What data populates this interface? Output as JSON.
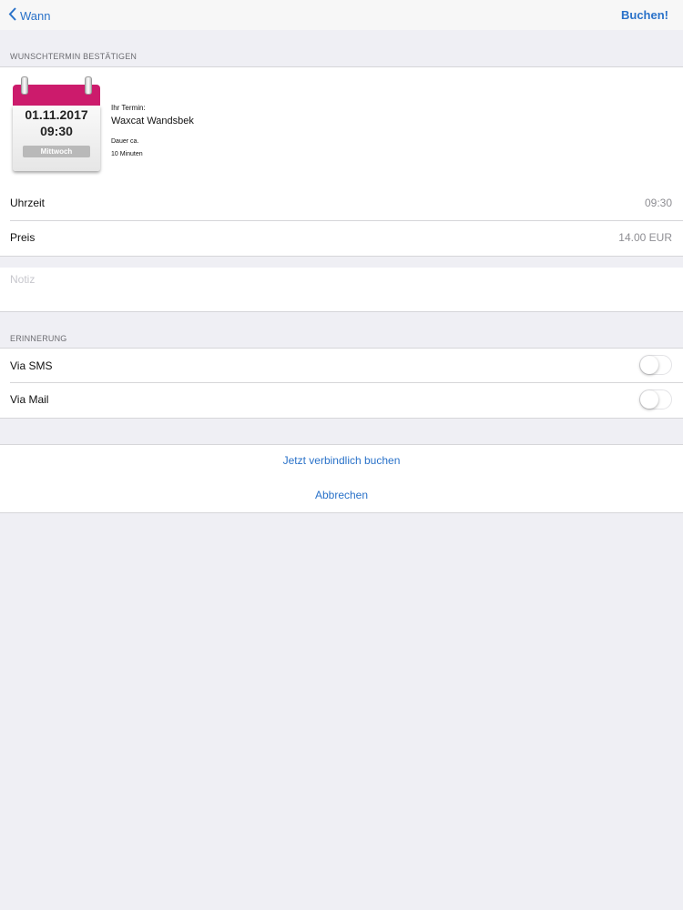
{
  "navbar": {
    "back_label": "Wann",
    "book_label": "Buchen!"
  },
  "confirm_section": {
    "header": "WUNSCHTERMIN BESTÄTIGEN",
    "calendar": {
      "date": "01.11.2017",
      "time": "09:30",
      "weekday": "Mittwoch"
    },
    "appointment_label": "Ihr Termin:",
    "appointment_name": "Waxcat Wandsbek",
    "duration_label": "Dauer ca.",
    "duration_value": "10 Minuten"
  },
  "details": {
    "time_label": "Uhrzeit",
    "time_value": "09:30",
    "price_label": "Preis",
    "price_value": "14.00 EUR"
  },
  "note": {
    "placeholder": "Notiz"
  },
  "reminder_section": {
    "header": "ERINNERUNG",
    "sms_label": "Via SMS",
    "sms_enabled": false,
    "mail_label": "Via Mail",
    "mail_enabled": false
  },
  "actions": {
    "book_now": "Jetzt verbindlich buchen",
    "cancel": "Abbrechen"
  },
  "colors": {
    "accent": "#2a72c9",
    "calendar_header": "#cc1b6c",
    "background": "#efeff4"
  }
}
